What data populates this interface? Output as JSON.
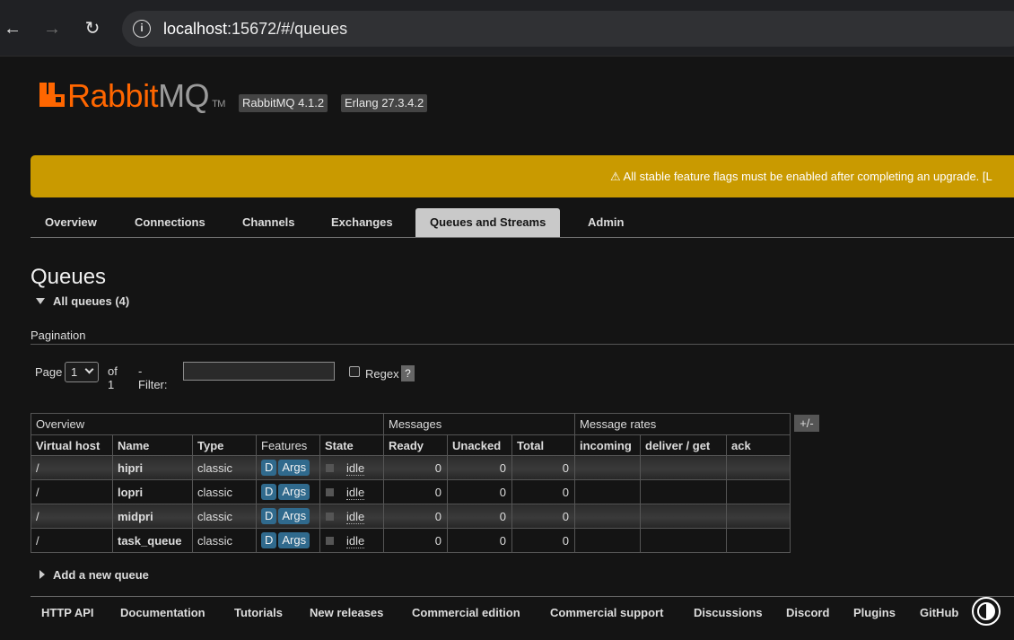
{
  "browser": {
    "url_host": "localhost",
    "url_rest": ":15672/#/queues"
  },
  "header": {
    "logo_rabbit": "Rabbit",
    "logo_mq": "MQ",
    "logo_tm": "TM",
    "rabbitmq_version": "RabbitMQ 4.1.2",
    "erlang_version": "Erlang 27.3.4.2"
  },
  "banner": {
    "text": "⚠ All stable feature flags must be enabled after completing an upgrade. [L"
  },
  "tabs": [
    {
      "label": "Overview"
    },
    {
      "label": "Connections"
    },
    {
      "label": "Channels"
    },
    {
      "label": "Exchanges"
    },
    {
      "label": "Queues and Streams"
    },
    {
      "label": "Admin"
    }
  ],
  "page": {
    "title": "Queues",
    "all_queues": "All queues (4)",
    "pagination_label": "Pagination",
    "page_label": "Page",
    "page_value": "1",
    "of_label": "of 1",
    "filter_label": "- Filter:",
    "filter_value": "",
    "regex_label": "Regex",
    "help_label": "?",
    "plus_minus": "+/-",
    "add_queue": "Add a new queue"
  },
  "table": {
    "group_headers": [
      "Overview",
      "Messages",
      "Message rates"
    ],
    "columns": [
      "Virtual host",
      "Name",
      "Type",
      "Features",
      "State",
      "Ready",
      "Unacked",
      "Total",
      "incoming",
      "deliver / get",
      "ack"
    ],
    "rows": [
      {
        "vhost": "/",
        "name": "hipri",
        "type": "classic",
        "f1": "D",
        "f2": "Args",
        "state": "idle",
        "ready": "0",
        "unacked": "0",
        "total": "0"
      },
      {
        "vhost": "/",
        "name": "lopri",
        "type": "classic",
        "f1": "D",
        "f2": "Args",
        "state": "idle",
        "ready": "0",
        "unacked": "0",
        "total": "0"
      },
      {
        "vhost": "/",
        "name": "midpri",
        "type": "classic",
        "f1": "D",
        "f2": "Args",
        "state": "idle",
        "ready": "0",
        "unacked": "0",
        "total": "0"
      },
      {
        "vhost": "/",
        "name": "task_queue",
        "type": "classic",
        "f1": "D",
        "f2": "Args",
        "state": "idle",
        "ready": "0",
        "unacked": "0",
        "total": "0"
      }
    ]
  },
  "footer": {
    "links": [
      "HTTP API",
      "Documentation",
      "Tutorials",
      "New releases",
      "Commercial edition",
      "Commercial support",
      "Discussions",
      "Discord",
      "Plugins",
      "GitHub"
    ]
  },
  "colors": {
    "brand_orange": "#ff6600",
    "banner_yellow": "#c99a00",
    "feature_badge": "#306a8d"
  }
}
